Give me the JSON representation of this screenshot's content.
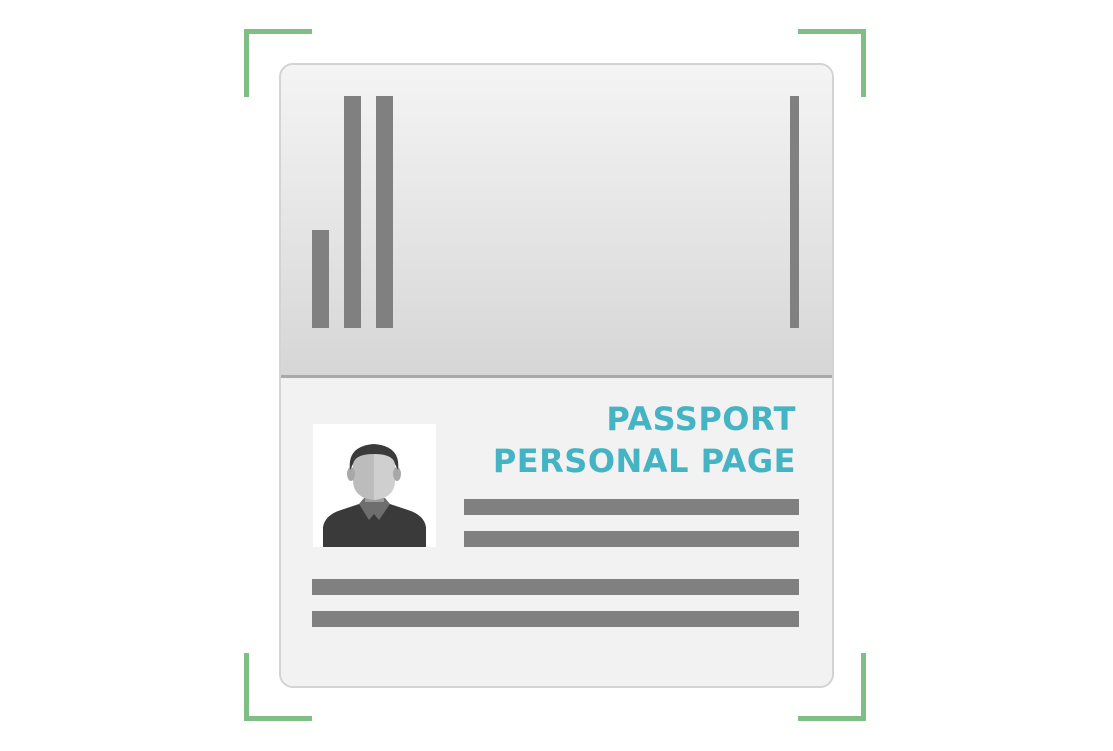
{
  "document": {
    "title_line1": "PASSPORT",
    "title_line2": "PERSONAL PAGE"
  },
  "colors": {
    "accent": "#44b4c4",
    "frame": "#7fbf86",
    "placeholder_bar": "#808080"
  },
  "icons": {
    "scan_frame": "corner-brackets",
    "portrait": "person-silhouette"
  }
}
